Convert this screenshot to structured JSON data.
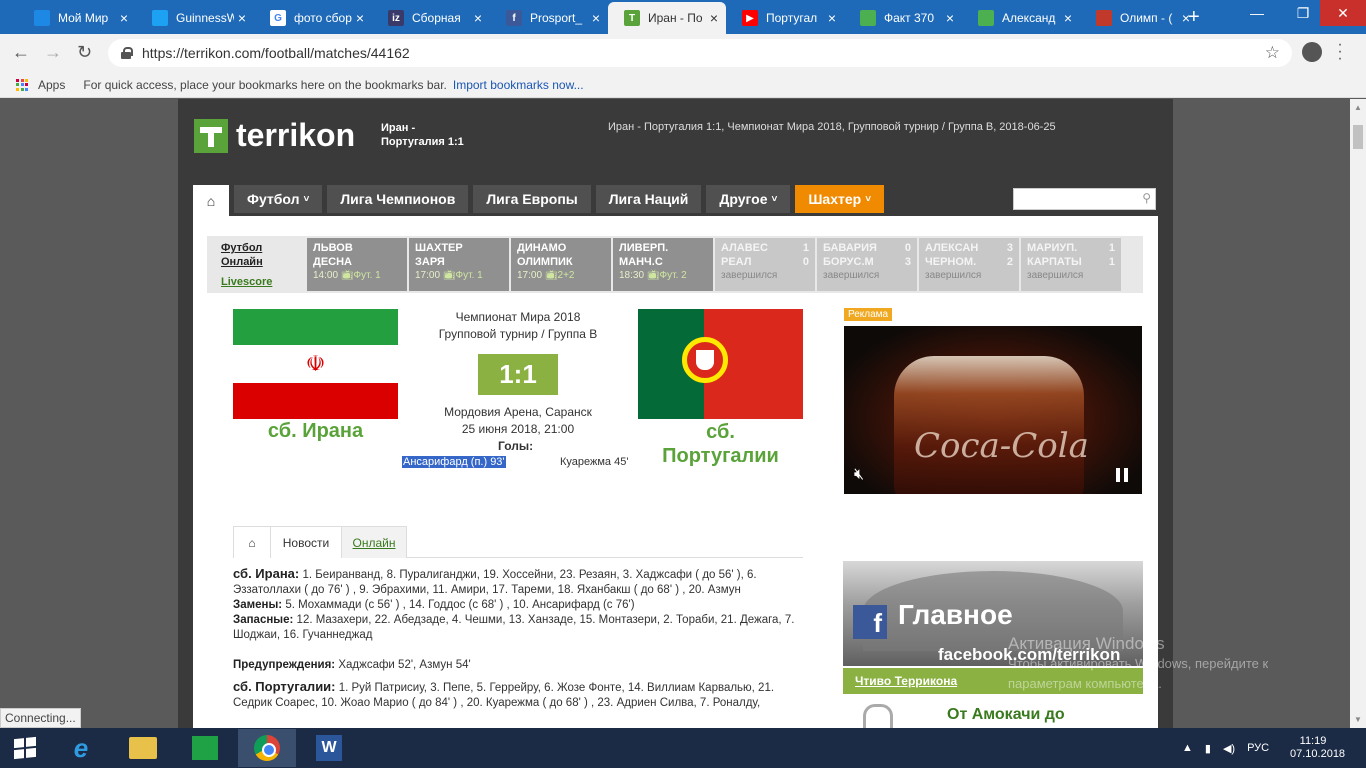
{
  "browser": {
    "tabs": [
      {
        "title": "Мой Мир",
        "icon": "mail-ru-icon",
        "color": "#1e88e5",
        "glyph": ""
      },
      {
        "title": "GuinnessW",
        "icon": "twitter-icon",
        "color": "#1da1f2",
        "glyph": ""
      },
      {
        "title": "фото сбор",
        "icon": "google-icon",
        "color": "#ffffff",
        "glyph": "G"
      },
      {
        "title": "Сборная",
        "icon": "iz-icon",
        "color": "#3a3a6a",
        "glyph": "iz"
      },
      {
        "title": "Prosport_",
        "icon": "facebook-icon",
        "color": "#3b5998",
        "glyph": "f"
      },
      {
        "title": "Иран - По",
        "icon": "terrikon-icon",
        "color": "#5aa33a",
        "glyph": "T"
      },
      {
        "title": "Португал",
        "icon": "youtube-icon",
        "color": "#ff0000",
        "glyph": "▶"
      },
      {
        "title": "Факт 370",
        "icon": "sheet-icon",
        "color": "#4caf50",
        "glyph": ""
      },
      {
        "title": "Александ",
        "icon": "sheet-icon",
        "color": "#4caf50",
        "glyph": ""
      },
      {
        "title": "Олимп - (",
        "icon": "olimp-icon",
        "color": "#c0392b",
        "glyph": ""
      }
    ],
    "active_tab": 5,
    "url": "https://terrikon.com/football/matches/44162",
    "bookmarks": {
      "apps_label": "Apps",
      "hint": "For quick access, place your bookmarks here on the bookmarks bar.",
      "import_link": "Import bookmarks now..."
    },
    "status": "Connecting..."
  },
  "site": {
    "logo": "terrikon",
    "header_match_line1": "Иран -",
    "header_match_line2": "Португалия 1:1",
    "header_desc": "Иран - Португалия 1:1, Чемпионат Мира 2018, Групповой турнир / Группа B, 2018-06-25",
    "nav": {
      "home_glyph": "⌂",
      "items": [
        {
          "label": "Футбол",
          "dropdown": true
        },
        {
          "label": "Лига Чемпионов",
          "dropdown": false
        },
        {
          "label": "Лига Европы",
          "dropdown": false
        },
        {
          "label": "Лига Наций",
          "dropdown": false
        },
        {
          "label": "Другое",
          "dropdown": true
        },
        {
          "label": "Шахтер",
          "dropdown": true,
          "accent": "#f08a00"
        }
      ]
    }
  },
  "ticker": {
    "online_line1": "Футбол",
    "online_line2": "Онлайн",
    "livescore": "Livescore",
    "matches": [
      {
        "home": "ЛЬВОВ",
        "away": "ДЕСНА",
        "home_score": "",
        "away_score": "",
        "time": "14:00",
        "tv": "Фут. 1",
        "finished": false
      },
      {
        "home": "ШАХТЕР",
        "away": "ЗАРЯ",
        "home_score": "",
        "away_score": "",
        "time": "17:00",
        "tv": "Фут. 1",
        "finished": false
      },
      {
        "home": "ДИНАМО",
        "away": "ОЛИМПИК",
        "home_score": "",
        "away_score": "",
        "time": "17:00",
        "tv": "2+2",
        "finished": false
      },
      {
        "home": "ЛИВЕРП.",
        "away": "МАНЧ.С",
        "home_score": "",
        "away_score": "",
        "time": "18:30",
        "tv": "Фут. 2",
        "finished": false
      },
      {
        "home": "АЛАВЕС",
        "away": "РЕАЛ",
        "home_score": "1",
        "away_score": "0",
        "time": "завершился",
        "tv": "",
        "finished": true
      },
      {
        "home": "БАВАРИЯ",
        "away": "БОРУС.М",
        "home_score": "0",
        "away_score": "3",
        "time": "завершился",
        "tv": "",
        "finished": true
      },
      {
        "home": "АЛЕКСАН",
        "away": "ЧЕРНОМ.",
        "home_score": "3",
        "away_score": "2",
        "time": "завершился",
        "tv": "",
        "finished": true
      },
      {
        "home": "МАРИУП.",
        "away": "КАРПАТЫ",
        "home_score": "1",
        "away_score": "1",
        "time": "завершился",
        "tv": "",
        "finished": true
      }
    ]
  },
  "match": {
    "tournament": "Чемпионат Мира 2018",
    "stage": "Групповой турнир / Группа B",
    "score": "1:1",
    "home": "сб. Ирана",
    "away_line1": "сб.",
    "away_line2": "Португалии",
    "venue": "Мордовия Арена, Саранск",
    "datetime": "25 июня 2018, 21:00",
    "goals_label": "Голы:",
    "home_goals": "Ансарифард (п.) 93'",
    "away_goals": "Куарежма 45'"
  },
  "ad": {
    "label": "Реклама",
    "brand": "Coca-Cola"
  },
  "tabs": {
    "home_glyph": "⌂",
    "news": "Новости",
    "online": "Онлайн"
  },
  "lineups": {
    "iran_team": "сб. Ирана:",
    "iran_players": "1. Беиранванд, 8. Пуралиганджи, 19. Хоссейни, 23. Резаян, 3. Хаджсафи ( до 56' ), 6. Эззатоллахи ( до 76' ) , 9. Эбрахими, 11. Амири, 17. Тареми, 18. Яханбакш ( до 68' ) , 20. Азмун",
    "iran_subs_label": "Замены:",
    "iran_subs": "5. Мохаммади (с 56' ) , 14. Годдос (с 68' ) , 10. Ансарифард (с 76')",
    "iran_reserve_label": "Запасные:",
    "iran_reserve": "12. Мазахери, 22. Абедзаде, 4. Чешми, 13. Ханзаде, 15. Монтазери, 2. Тораби, 21. Дежага, 7. Шоджаи, 16. Гучаннеджад",
    "warnings_label": "Предупреждения:",
    "warnings": "Хаджсафи 52', Азмун 54'",
    "portugal_team": "сб. Португалии:",
    "portugal_players": "1. Руй Патрисиу, 3. Пепе, 5. Геррейру, 6. Жозе Фонте, 14. Виллиам Карвалью, 21. Седрик Соарес, 10. Жоао Марио ( до 84' ) , 20. Куарежма ( до 68' ) , 23. Адриен Силва, 7. Роналду,"
  },
  "sidebar": {
    "fb_title": "Главное",
    "fb_url": "facebook.com/terrikon",
    "chtivo": "Чтиво Терриконa",
    "teaser": "От Амокачи до"
  },
  "watermark": {
    "line1": "Активация Windows",
    "line2": "Чтобы активировать Windows, перейдите к",
    "line3": "параметрам компьютера."
  },
  "taskbar": {
    "lang": "РУС",
    "time": "11:19",
    "date": "07.10.2018"
  }
}
